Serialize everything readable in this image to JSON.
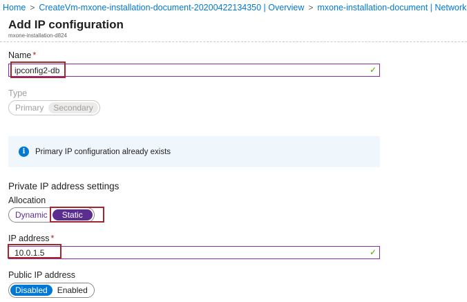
{
  "breadcrumb": {
    "items": [
      "Home",
      "CreateVm-mxone-installation-document-20200422134350 | Overview",
      "mxone-installation-document | Networking"
    ],
    "separator": ">"
  },
  "page": {
    "title": "Add IP configuration",
    "subtitle": "mxone-installation-d824"
  },
  "name_field": {
    "label": "Name",
    "required_mark": "*",
    "value": "ipconfig2-db",
    "valid_mark": "✓"
  },
  "type_field": {
    "label": "Type",
    "options": [
      "Primary",
      "Secondary"
    ],
    "selected": "Secondary"
  },
  "info_banner": {
    "icon": "info-icon",
    "text": "Primary IP configuration already exists"
  },
  "private_ip": {
    "section_title": "Private IP address settings",
    "allocation_label": "Allocation",
    "allocation_options": [
      "Dynamic",
      "Static"
    ],
    "allocation_selected": "Static",
    "ip_label": "IP address",
    "required_mark": "*",
    "ip_value": "10.0.1.5",
    "valid_mark": "✓"
  },
  "public_ip": {
    "label": "Public IP address",
    "options": [
      "Disabled",
      "Enabled"
    ],
    "selected": "Disabled"
  },
  "colors": {
    "accent_purple": "#5c2d91",
    "accent_blue": "#0078d4",
    "highlight_red": "#a4262c",
    "valid_green": "#57a300"
  }
}
